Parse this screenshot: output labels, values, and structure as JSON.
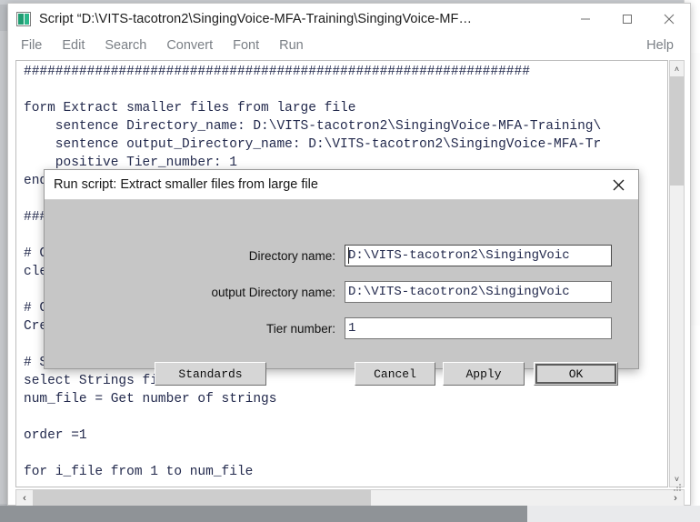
{
  "window": {
    "title": "Script “D:\\VITS-tacotron2\\SingingVoice-MFA-Training\\SingingVoice-MF…",
    "icon": "praat-script-icon",
    "minimize": "–",
    "maximize": "□",
    "close": "✕"
  },
  "menubar": {
    "items": [
      {
        "label": "File"
      },
      {
        "label": "Edit"
      },
      {
        "label": "Search"
      },
      {
        "label": "Convert"
      },
      {
        "label": "Font"
      },
      {
        "label": "Run"
      }
    ],
    "help": "Help"
  },
  "editor": {
    "code": "################################################################\n\nform Extract smaller files from large file\n    sentence Directory_name: D:\\VITS-tacotron2\\SingingVoice-MFA-Training\\\n    sentence output_Directory_name: D:\\VITS-tacotron2\\SingingVoice-MFA-Tr\n    positive Tier_number: 1\nendform\n\n################################################################\n\n# Clear the Praat Objects list                                id\"\nclear all\n\n# Create a Strings list of all the files in the directory      ory\nCreate Strings as file list: \"fileList\", directory_name$ + \"*.wav\"\n\n# Select the Strings object\nselect Strings fileList\nnum_file = Get number of strings\n\norder =1\n\nfor i_file from 1 to num_file\n"
  },
  "scrollbars": {
    "vertical_up": "˄",
    "vertical_down": "˅",
    "horizontal_left": "‹",
    "horizontal_right": "›"
  },
  "dialog": {
    "title": "Run script: Extract smaller files from large file",
    "close_icon": "✕",
    "fields": [
      {
        "label": "Directory name:",
        "value": "D:\\VITS-tacotron2\\SingingVoic",
        "focused": true
      },
      {
        "label": "output Directory name:",
        "value": "D:\\VITS-tacotron2\\SingingVoic",
        "focused": false
      },
      {
        "label": "Tier number:",
        "value": "1",
        "focused": false
      }
    ],
    "buttons": {
      "standards": "Standards",
      "cancel": "Cancel",
      "apply": "Apply",
      "ok": "OK"
    }
  },
  "colors": {
    "code_text": "#232a4d",
    "dialog_face": "#c6c6c6",
    "titlebar": "#ffffff",
    "menu_text": "#7a7f85",
    "accent_icon": "#2bb689"
  }
}
